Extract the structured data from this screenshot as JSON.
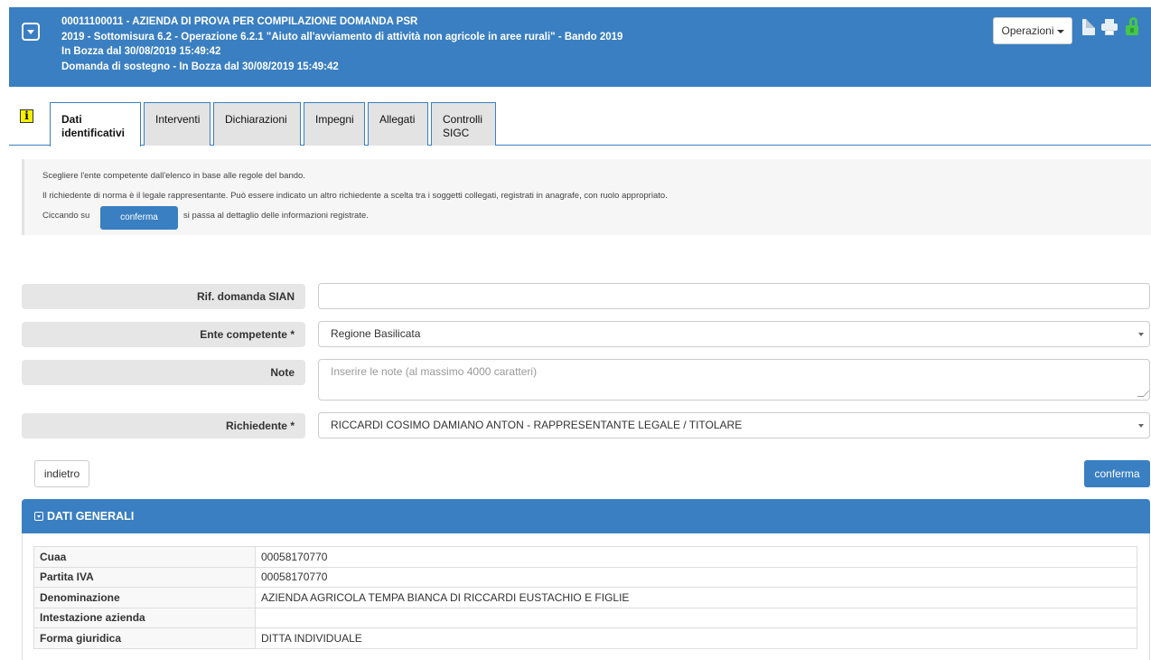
{
  "header": {
    "lines": [
      "00011100011 - AZIENDA DI PROVA PER COMPILAZIONE DOMANDA PSR",
      "2019 - Sottomisura 6.2 - Operazione 6.2.1 \"Aiuto all'avviamento di attività non agricole in aree rurali\" - Bando 2019",
      "In Bozza dal 30/08/2019 15:49:42",
      "Domanda di sostegno - In Bozza dal 30/08/2019 15:49:42"
    ],
    "operations_label": "Operazioni",
    "icons": [
      "document-icon",
      "print-icon",
      "unlock-icon"
    ]
  },
  "tabs": [
    {
      "label": "Dati identificativi",
      "active": true
    },
    {
      "label": "Interventi",
      "active": false
    },
    {
      "label": "Dichiarazioni",
      "active": false
    },
    {
      "label": "Impegni",
      "active": false
    },
    {
      "label": "Allegati",
      "active": false
    },
    {
      "label": "Controlli SIGC",
      "active": false
    }
  ],
  "info": {
    "line1": "Scegliere l'ente competente dall'elenco in base alle regole del bando.",
    "line2": "Il richiedente di norma è il legale rappresentante. Può essere indicato un altro richiedente a scelta tra i soggetti collegati, registrati in anagrafe, con ruolo appropriato.",
    "line3_before": "Ciccando su",
    "line3_button": "conferma",
    "line3_after": "si passa al dettaglio delle informazioni registrate."
  },
  "form": {
    "rif_label": "Rif. domanda SIAN",
    "rif_value": "",
    "ente_label": "Ente competente *",
    "ente_value": "Regione Basilicata",
    "note_label": "Note",
    "note_placeholder": "Inserire le note (al massimo 4000 caratteri)",
    "richiedente_label": "Richiedente *",
    "richiedente_value": "RICCARDI COSIMO DAMIANO ANTON - RAPPRESENTANTE LEGALE / TITOLARE"
  },
  "buttons": {
    "back": "indietro",
    "confirm": "conferma"
  },
  "dati_generali": {
    "title": "DATI GENERALI",
    "rows": [
      {
        "key": "Cuaa",
        "value": "00058170770"
      },
      {
        "key": "Partita IVA",
        "value": "00058170770"
      },
      {
        "key": "Denominazione",
        "value": "AZIENDA AGRICOLA TEMPA BIANCA DI RICCARDI EUSTACHIO E FIGLIE"
      },
      {
        "key": "Intestazione azienda",
        "value": ""
      },
      {
        "key": "Forma giuridica",
        "value": "DITTA INDIVIDUALE"
      }
    ]
  },
  "colors": {
    "primary": "#3a7fc1",
    "label_bg": "#e6e6e6",
    "unlock": "#45c64a"
  }
}
